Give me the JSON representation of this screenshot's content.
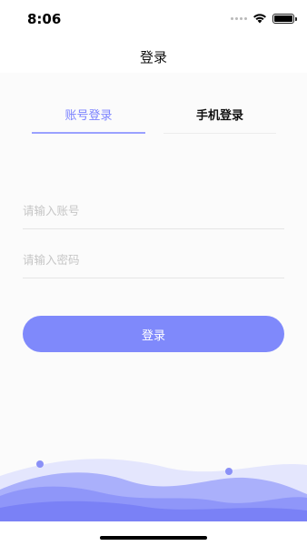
{
  "status_bar": {
    "time": "8:06"
  },
  "nav": {
    "title": "登录"
  },
  "tabs": [
    {
      "label": "账号登录",
      "active": true
    },
    {
      "label": "手机登录",
      "active": false
    }
  ],
  "form": {
    "account_placeholder": "请输入账号",
    "password_placeholder": "请输入密码",
    "submit_label": "登录"
  },
  "colors": {
    "accent": "#7f89fb",
    "active_tab_text": "#7c83ff",
    "wave_light": "#e4e6fd",
    "wave_mid": "#aab0fb",
    "wave_dark": "#7f86f8"
  }
}
